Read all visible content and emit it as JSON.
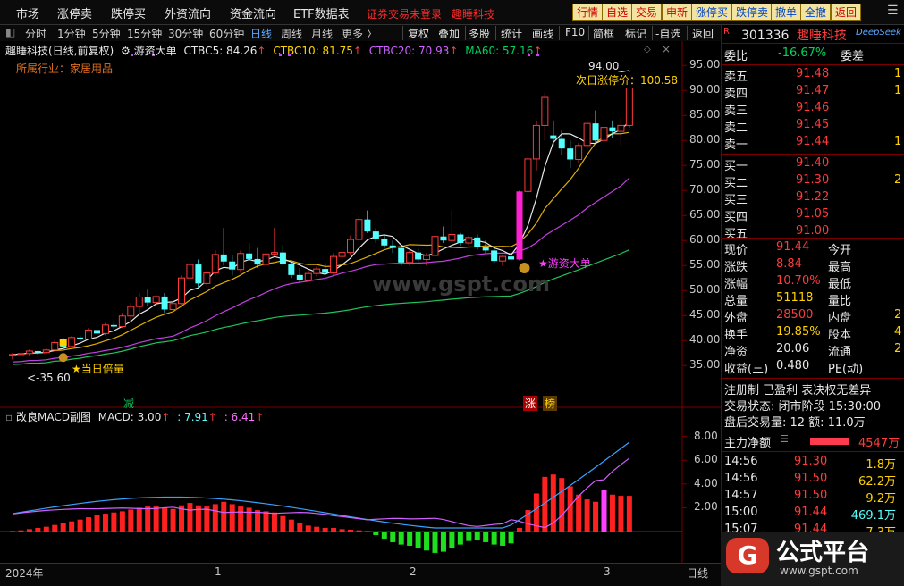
{
  "top_menu": [
    "市场",
    "涨停卖",
    "跌停买",
    "外资流向",
    "资金流向",
    "ETF数据表"
  ],
  "login_status": "证券交易未登录",
  "stock_title_top": "趣睡科技",
  "top_buttons": [
    "行情",
    "自选",
    "交易",
    "申新",
    "涨停买",
    "跌停卖",
    "撤单",
    "全撤",
    "返回"
  ],
  "timeframes": [
    "分时",
    "1分钟",
    "5分钟",
    "15分钟",
    "30分钟",
    "60分钟",
    "日线",
    "周线",
    "月线",
    "更多"
  ],
  "active_timeframe": "日线",
  "tools": [
    "复权",
    "叠加",
    "多股",
    "统计",
    "画线",
    "F10",
    "简框",
    "标记",
    "-自选",
    "返回"
  ],
  "indicator_line": {
    "name": "趣睡科技(日线,前复权)",
    "indicator": "游资大单",
    "ctbc5": "CTBC5: 84.26",
    "ctbc10": "CTBC10: 81.75",
    "ctbc20": "CTBC20: 70.93",
    "ma60": "MA60: 57.16"
  },
  "industry": "所属行业：家居用品",
  "annotations": {
    "high_price": "94.00",
    "next_limit": "次日涨停价：100.58",
    "low_price": "35.60",
    "star_label": "★游资大单",
    "volume_label": "★当日倍量",
    "jian": "减",
    "zhang": "涨",
    "bang": "榜",
    "watermark": "www.gspt.com"
  },
  "price_ticks": [
    "95.00",
    "90.00",
    "85.00",
    "80.00",
    "75.00",
    "70.00",
    "65.00",
    "60.00",
    "55.00",
    "50.00",
    "45.00",
    "40.00",
    "35.00"
  ],
  "macd": {
    "title": "改良MACD副图",
    "macd": "MACD: 3.00",
    "dif": ": 7.91",
    "dea": ": 6.41",
    "ticks": [
      "8.00",
      "6.00",
      "4.00",
      "2.00"
    ]
  },
  "bottom": {
    "year": "2024年",
    "months": [
      "1",
      "2",
      "3"
    ],
    "period": "日线"
  },
  "right_panel": {
    "code": "301336",
    "name": "趣睡科技",
    "brand": "DeepSeek",
    "webi_label": "委比",
    "webi": "-16.67%",
    "weicha_label": "委差",
    "asks": [
      {
        "label": "卖五",
        "price": "91.48",
        "vol": "1"
      },
      {
        "label": "卖四",
        "price": "91.47",
        "vol": "1"
      },
      {
        "label": "卖三",
        "price": "91.46",
        "vol": ""
      },
      {
        "label": "卖二",
        "price": "91.45",
        "vol": ""
      },
      {
        "label": "卖一",
        "price": "91.44",
        "vol": "1"
      }
    ],
    "bids": [
      {
        "label": "买一",
        "price": "91.40",
        "vol": ""
      },
      {
        "label": "买二",
        "price": "91.30",
        "vol": "2"
      },
      {
        "label": "买三",
        "price": "91.22",
        "vol": ""
      },
      {
        "label": "买四",
        "price": "91.05",
        "vol": ""
      },
      {
        "label": "买五",
        "price": "91.00",
        "vol": ""
      }
    ],
    "stats": [
      {
        "l1": "现价",
        "v1": "91.44",
        "l2": "今开",
        "v2": ""
      },
      {
        "l1": "涨跌",
        "v1": "8.84",
        "l2": "最高",
        "v2": ""
      },
      {
        "l1": "涨幅",
        "v1": "10.70%",
        "l2": "最低",
        "v2": ""
      },
      {
        "l1": "总量",
        "v1": "51118",
        "l2": "量比",
        "v2": ""
      },
      {
        "l1": "外盘",
        "v1": "28500",
        "l2": "内盘",
        "v2": "2"
      },
      {
        "l1": "换手",
        "v1": "19.85%",
        "l2": "股本",
        "v2": "4"
      },
      {
        "l1": "净资",
        "v1": "20.06",
        "l2": "流通",
        "v2": "2"
      },
      {
        "l1": "收益(三)",
        "v1": "0.480",
        "l2": "PE(动)",
        "v2": ""
      }
    ],
    "registration": "注册制  已盈利  表决权无差异",
    "trade_status": "交易状态: 闭市阶段 15:30:00",
    "after_hours": "盘后交易量: 12  额: 11.0万",
    "main_flow_label": "主力净额",
    "main_flow": "4547万",
    "ticks": [
      {
        "time": "14:56",
        "price": "91.30",
        "vol": "1.8万"
      },
      {
        "time": "14:56",
        "price": "91.50",
        "vol": "62.2万"
      },
      {
        "time": "14:57",
        "price": "91.50",
        "vol": "9.2万"
      },
      {
        "time": "15:00",
        "price": "91.44",
        "vol": "469.1万"
      },
      {
        "time": "15:07",
        "price": "91.44",
        "vol": "7.3万"
      }
    ],
    "logo_text": "公式平台",
    "logo_url": "www.gspt.com"
  },
  "chart_data": {
    "type": "candlestick",
    "title": "趣睡科技(日线,前复权)",
    "ylim": [
      32,
      97
    ],
    "candles": [
      [
        37.0,
        37.5,
        36.2,
        37.2
      ],
      [
        37.2,
        37.8,
        36.8,
        37.4
      ],
      [
        37.4,
        38.2,
        37.0,
        37.9
      ],
      [
        37.9,
        38.0,
        37.2,
        37.6
      ],
      [
        37.6,
        38.4,
        37.3,
        38.1
      ],
      [
        38.1,
        40.0,
        37.9,
        39.6
      ],
      [
        39.6,
        40.5,
        38.5,
        38.8
      ],
      [
        38.8,
        40.9,
        38.6,
        40.6
      ],
      [
        40.6,
        41.0,
        39.8,
        40.3
      ],
      [
        40.3,
        42.5,
        40.1,
        42.1
      ],
      [
        42.1,
        42.8,
        40.9,
        41.4
      ],
      [
        41.4,
        43.5,
        41.0,
        43.1
      ],
      [
        43.1,
        44.0,
        42.3,
        42.8
      ],
      [
        42.8,
        45.5,
        42.5,
        44.9
      ],
      [
        44.9,
        47.5,
        44.0,
        46.8
      ],
      [
        46.8,
        49.5,
        45.5,
        48.7
      ],
      [
        48.7,
        50.2,
        47.0,
        47.6
      ],
      [
        47.6,
        49.2,
        46.8,
        48.8
      ],
      [
        48.8,
        49.5,
        45.5,
        46.2
      ],
      [
        46.2,
        48.0,
        45.8,
        47.4
      ],
      [
        47.4,
        53.0,
        47.0,
        52.5
      ],
      [
        52.5,
        56.0,
        52.0,
        55.2
      ],
      [
        55.2,
        56.2,
        50.5,
        51.4
      ],
      [
        51.4,
        54.0,
        50.8,
        53.5
      ],
      [
        53.5,
        58.0,
        53.0,
        57.2
      ],
      [
        57.2,
        62.5,
        55.0,
        55.8
      ],
      [
        55.8,
        57.0,
        53.0,
        54.2
      ],
      [
        54.2,
        58.0,
        53.5,
        57.4
      ],
      [
        57.4,
        59.5,
        56.0,
        56.3
      ],
      [
        56.3,
        58.5,
        54.5,
        55.2
      ],
      [
        55.2,
        58.0,
        54.8,
        57.3
      ],
      [
        57.3,
        62.5,
        56.8,
        57.6
      ],
      [
        57.6,
        59.0,
        55.0,
        55.3
      ],
      [
        55.3,
        56.0,
        52.5,
        53.1
      ],
      [
        53.1,
        54.5,
        51.5,
        52.0
      ],
      [
        52.0,
        54.0,
        51.8,
        53.4
      ],
      [
        53.4,
        54.8,
        52.8,
        54.3
      ],
      [
        54.3,
        55.5,
        53.5,
        53.5
      ],
      [
        53.5,
        57.5,
        53.0,
        56.8
      ],
      [
        56.8,
        58.0,
        55.5,
        57.6
      ],
      [
        57.6,
        61.0,
        57.0,
        60.2
      ],
      [
        60.2,
        65.5,
        59.0,
        64.2
      ],
      [
        64.2,
        66.0,
        61.5,
        61.8
      ],
      [
        61.8,
        62.5,
        59.5,
        60.4
      ],
      [
        60.4,
        61.0,
        58.5,
        59.0
      ],
      [
        59.0,
        60.0,
        57.5,
        58.5
      ],
      [
        58.5,
        59.0,
        55.0,
        55.6
      ],
      [
        55.6,
        58.0,
        55.0,
        57.6
      ],
      [
        57.6,
        58.5,
        55.5,
        56.2
      ],
      [
        56.2,
        57.5,
        55.0,
        57.0
      ],
      [
        57.0,
        61.5,
        56.5,
        60.8
      ],
      [
        60.8,
        62.8,
        59.5,
        60.0
      ],
      [
        60.0,
        66.0,
        59.5,
        61.2
      ],
      [
        61.2,
        61.5,
        59.0,
        59.5
      ],
      [
        59.5,
        61.0,
        59.0,
        60.6
      ],
      [
        60.6,
        61.2,
        58.2,
        58.6
      ],
      [
        58.6,
        60.0,
        57.5,
        58.0
      ],
      [
        58.0,
        58.5,
        55.5,
        55.9
      ],
      [
        55.9,
        57.0,
        55.0,
        56.8
      ],
      [
        56.8,
        57.5,
        55.8,
        56.2
      ],
      [
        56.2,
        70.0,
        56.0,
        69.8
      ],
      [
        69.8,
        77.0,
        68.0,
        76.3
      ],
      [
        76.3,
        84.0,
        74.0,
        83.0
      ],
      [
        83.0,
        89.5,
        80.0,
        88.6
      ],
      [
        81.0,
        84.0,
        79.0,
        80.3
      ],
      [
        80.3,
        82.0,
        77.0,
        78.4
      ],
      [
        78.4,
        80.0,
        74.5,
        76.2
      ],
      [
        76.2,
        79.5,
        75.5,
        79.0
      ],
      [
        79.0,
        84.0,
        78.0,
        83.4
      ],
      [
        83.4,
        86.0,
        79.5,
        80.0
      ],
      [
        80.0,
        85.5,
        79.0,
        82.6
      ],
      [
        82.6,
        84.0,
        80.5,
        81.8
      ],
      [
        81.8,
        84.5,
        79.0,
        83.0
      ],
      [
        83.0,
        94.0,
        82.5,
        91.44
      ]
    ],
    "macd_bars": [
      0.05,
      0.1,
      0.2,
      0.3,
      0.4,
      0.55,
      0.7,
      0.85,
      1.0,
      1.2,
      1.4,
      1.5,
      1.6,
      1.7,
      1.85,
      2.0,
      2.1,
      2.1,
      2.0,
      1.9,
      2.2,
      2.4,
      2.2,
      2.1,
      2.3,
      2.5,
      2.3,
      2.1,
      2.0,
      1.8,
      1.7,
      1.6,
      1.3,
      1.0,
      0.7,
      0.5,
      0.4,
      0.3,
      0.3,
      0.2,
      0.15,
      0.1,
      0.05,
      -0.3,
      -0.6,
      -0.9,
      -1.1,
      -1.2,
      -1.4,
      -1.6,
      -1.8,
      -1.7,
      -1.4,
      -1.1,
      -0.8,
      -0.7,
      -0.9,
      -1.1,
      -1.2,
      -1.0,
      0.3,
      1.8,
      3.2,
      4.6,
      4.8,
      4.5,
      3.8,
      3.1,
      2.7,
      2.5,
      3.5,
      3.1,
      3.0,
      3.0
    ],
    "dif_range": [
      0,
      8.5
    ]
  }
}
